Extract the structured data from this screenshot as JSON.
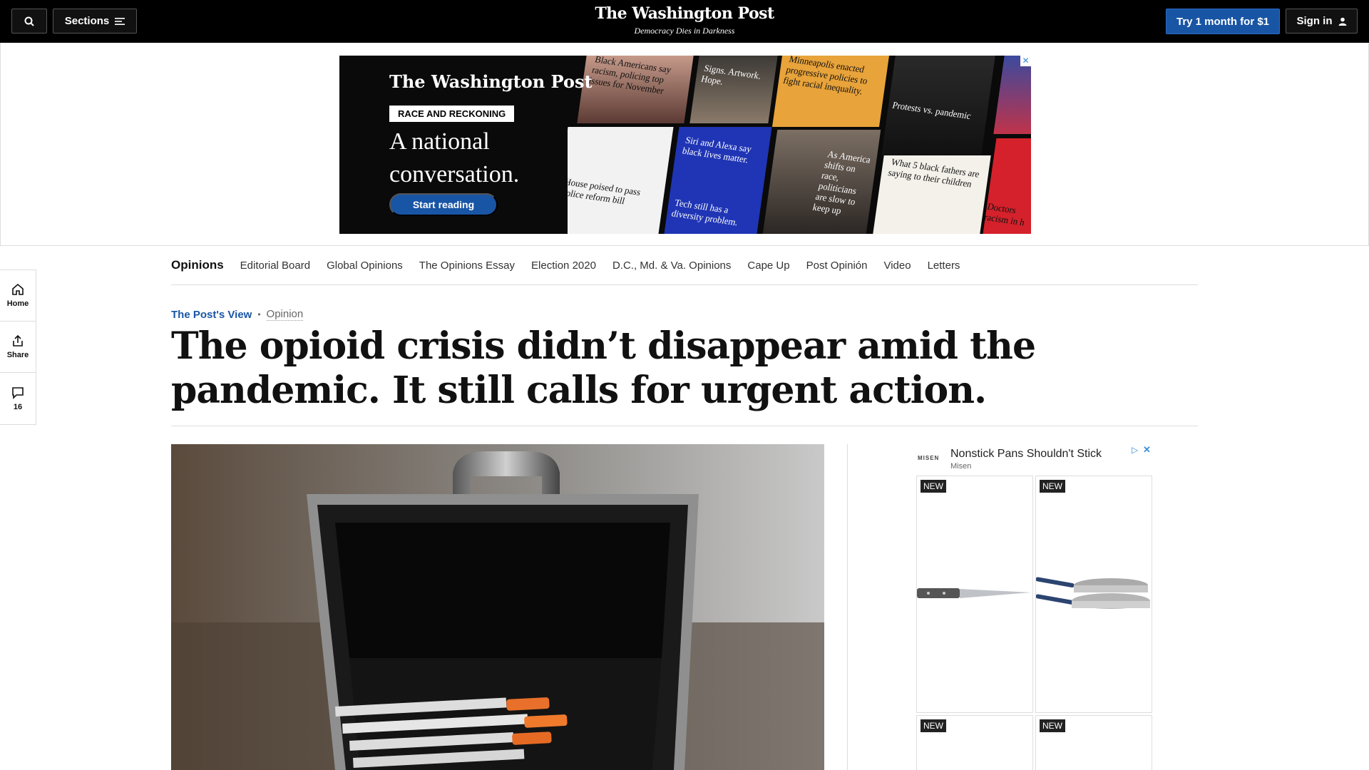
{
  "topbar": {
    "sections_label": "Sections",
    "logo": "The Washington Post",
    "tagline": "Democracy Dies in Darkness",
    "try_label": "Try 1 month for $1",
    "signin_label": "Sign in"
  },
  "banner": {
    "logo": "The Washington Post",
    "tag": "RACE AND RECKONING",
    "headline": "A national conversation.",
    "cta": "Start reading",
    "tiles": [
      "Black Americans say racism, policing top issues for November",
      "Signs. Artwork. Hope.",
      "Minneapolis enacted progressive policies to fight racial inequality.",
      "Protests vs. pandemic",
      "House poised to pass police reform bill",
      "Siri and Alexa say black lives matter.",
      "Tech still has a diversity problem.",
      "As America shifts on race, politicians are slow to keep up",
      "What 5 black fathers are saying to their children",
      "Doctors racism in h"
    ]
  },
  "nav": {
    "current": "Opinions",
    "items": [
      "Editorial Board",
      "Global Opinions",
      "The Opinions Essay",
      "Election 2020",
      "D.C., Md. & Va. Opinions",
      "Cape Up",
      "Post Opinión",
      "Video",
      "Letters"
    ]
  },
  "rail": {
    "home": "Home",
    "share": "Share",
    "comments": "16"
  },
  "article": {
    "kicker": "The Post's View",
    "section": "Opinion",
    "headline": "The opioid crisis didn’t disappear amid the pandemic. It still calls for urgent action."
  },
  "side_ad": {
    "brand": "MISEN",
    "title": "Nonstick Pans Shouldn't Stick",
    "subtitle": "Misen",
    "badge": "NEW"
  },
  "colors": {
    "accent_blue": "#1955a5",
    "topbar": "#000000"
  }
}
